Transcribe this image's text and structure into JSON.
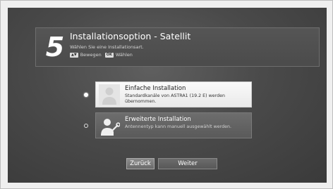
{
  "header": {
    "step_number": "5",
    "title": "Installationsoption - Satellit",
    "subtitle": "Wählen Sie eine Installationsart.",
    "hints": [
      {
        "key": "▲▼",
        "label": "Bewegen"
      },
      {
        "key": "OK",
        "label": "Wählen"
      }
    ]
  },
  "options": [
    {
      "title": "Einfache Installation",
      "description": "Standardkanäle von ASTRA1 (19.2 E) werden übernommen.",
      "selected": true,
      "icon": "person-icon"
    },
    {
      "title": "Erweiterte Installation",
      "description": "Antennentyp kann manuell ausgewählt werden.",
      "selected": false,
      "icon": "person-wrench-icon"
    }
  ],
  "buttons": {
    "back_label": "Zurück",
    "next_label": "Weiter"
  },
  "colors": {
    "background": "#4a4a4a",
    "selected_option": "#f5f5f5",
    "text_light": "#ffffff"
  }
}
